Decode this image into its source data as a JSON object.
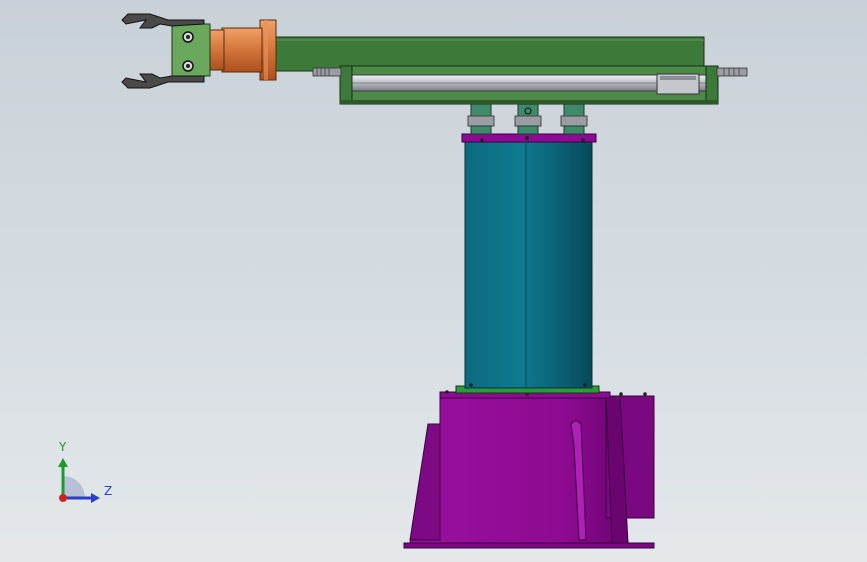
{
  "app": {
    "view": "cad-model-viewport"
  },
  "colors": {
    "background_top": "#c9d1d8",
    "background_bottom": "#e4e8eb",
    "base": "#8e0a92",
    "base_dark": "#6a0570",
    "column": "#0f7386",
    "column_dark": "#074d5e",
    "arm": "#3d7a3a",
    "arm_light": "#5a9a52",
    "copper": "#d3753a",
    "gripper": "#4a4a4a",
    "rail": "#b8bcc2"
  },
  "triad": {
    "y_label": "Y",
    "z_label": "Z",
    "x_color": "#d42222",
    "y_color": "#1f9a2a",
    "z_color": "#2a3fc9"
  },
  "model": {
    "parts": [
      "gripper",
      "wrist",
      "horizontal-arm",
      "linear-guide",
      "bearings",
      "column",
      "base"
    ]
  }
}
